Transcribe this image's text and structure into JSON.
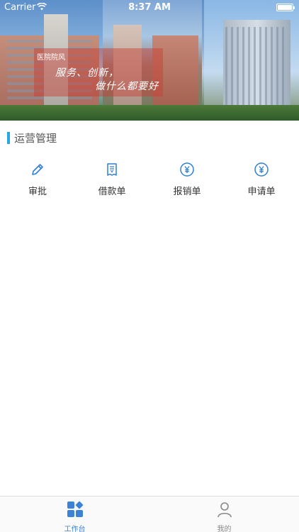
{
  "status_bar": {
    "carrier": "Carrier",
    "time": "8:37 AM"
  },
  "banner": {
    "tag": "医院院风",
    "slogan_line1": "服务、创新，",
    "slogan_line2": "做什么都要好"
  },
  "section": {
    "title": "运营管理"
  },
  "functions": [
    {
      "label": "审批",
      "icon": "pencil-icon"
    },
    {
      "label": "借款单",
      "icon": "receipt-icon"
    },
    {
      "label": "报销单",
      "icon": "yen-circle-icon"
    },
    {
      "label": "申请单",
      "icon": "yen-circle-icon"
    }
  ],
  "tabbar": {
    "tabs": [
      {
        "label": "工作台",
        "icon": "grid-icon",
        "active": true
      },
      {
        "label": "我的",
        "icon": "person-icon",
        "active": false
      }
    ]
  },
  "colors": {
    "accent": "#3d82d6",
    "section_bar": "#2aa7e0",
    "icon_blue": "#2f7fd0"
  }
}
